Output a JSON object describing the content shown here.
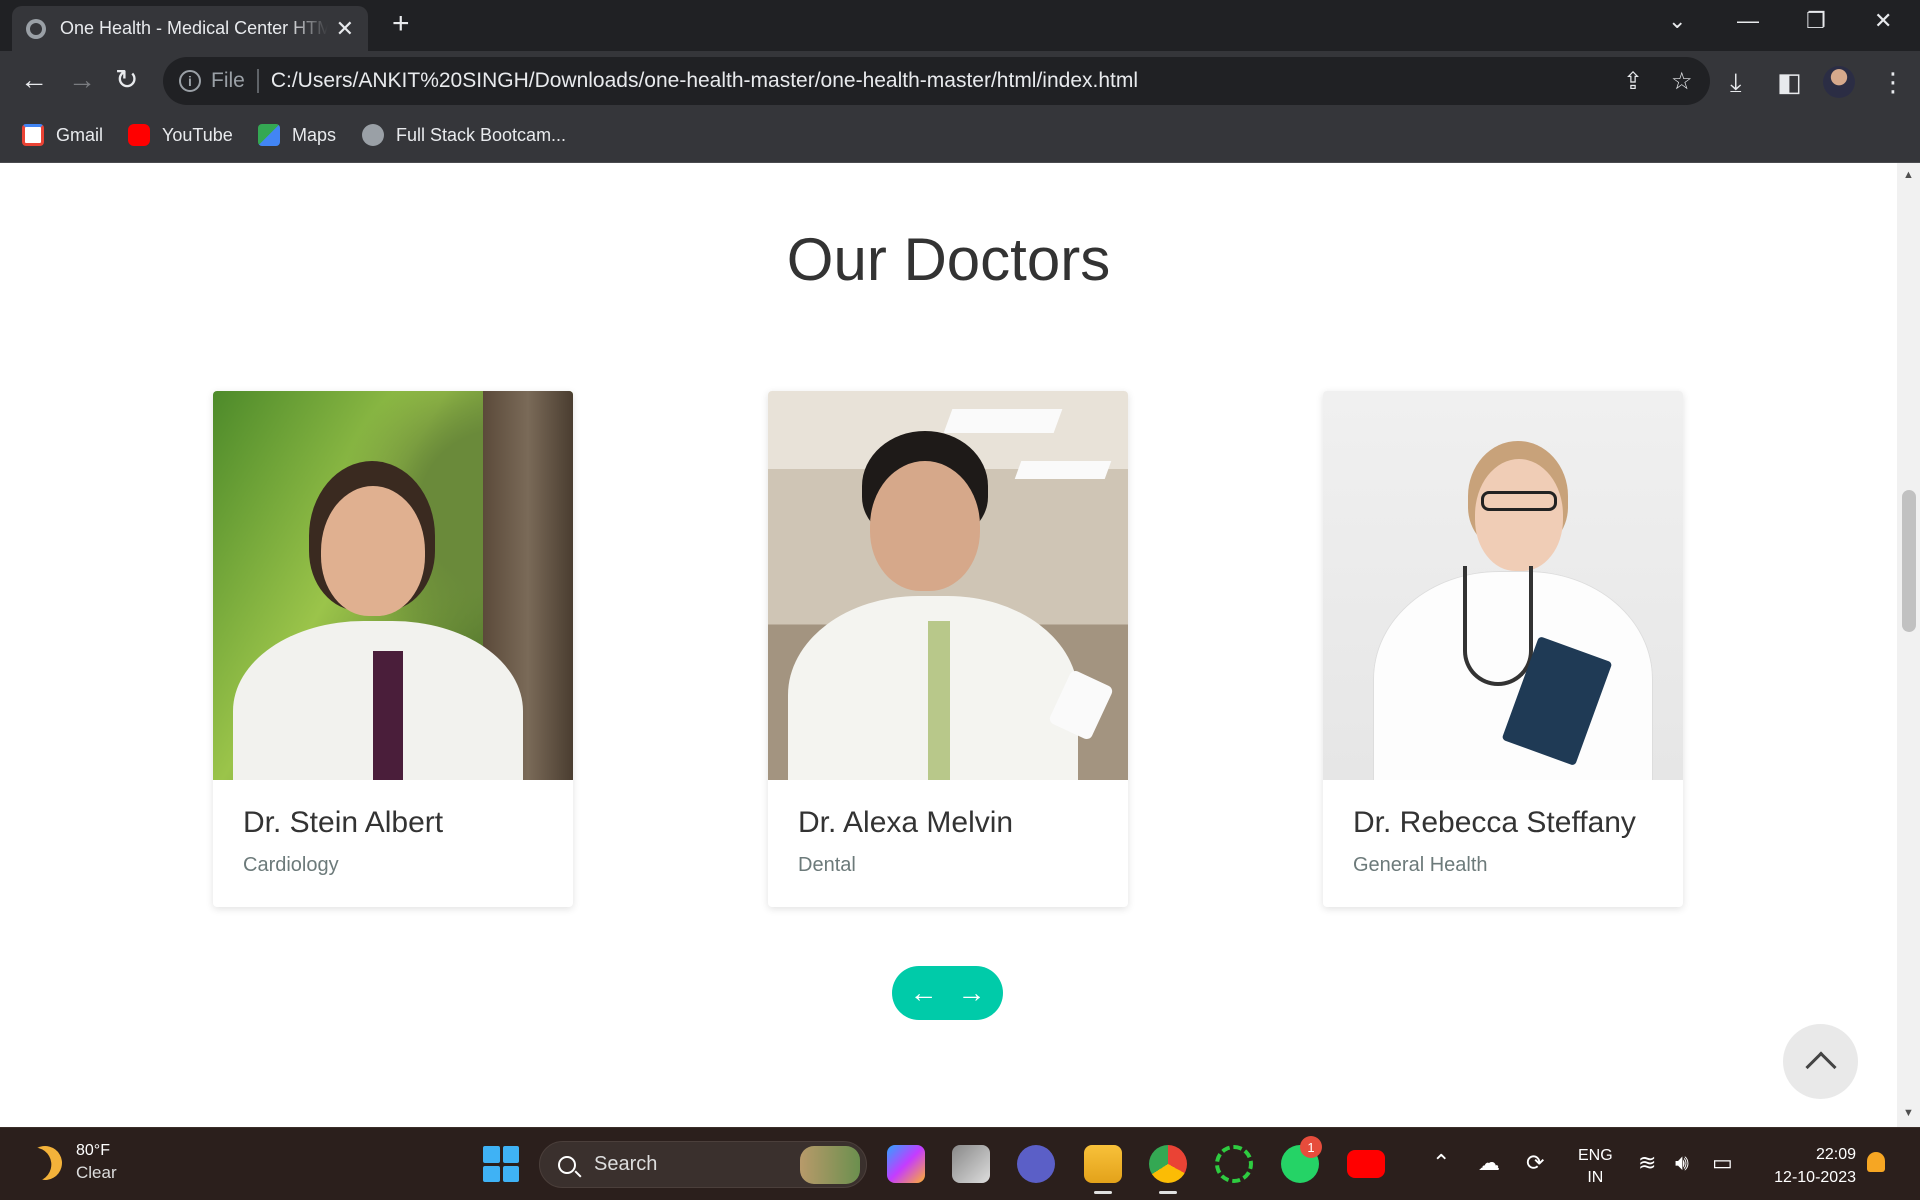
{
  "browser": {
    "tab_title": "One Health - Medical Center HTML",
    "tab_close": "✕",
    "new_tab": "+",
    "url_scheme": "File",
    "url": "C:/Users/ANKIT%20SINGH/Downloads/one-health-master/one-health-master/html/index.html",
    "bookmarks": [
      {
        "label": "Gmail",
        "icon": "gmail-icon",
        "color": "#ea4335"
      },
      {
        "label": "YouTube",
        "icon": "youtube-icon",
        "color": "#ff0000"
      },
      {
        "label": "Maps",
        "icon": "maps-icon",
        "color": "#34a853"
      },
      {
        "label": "Full Stack Bootcam...",
        "icon": "globe-icon",
        "color": "#9aa0a6"
      }
    ]
  },
  "page": {
    "section_title": "Our Doctors",
    "doctors": [
      {
        "name": "Dr. Stein Albert",
        "specialty": "Cardiology"
      },
      {
        "name": "Dr. Alexa Melvin",
        "specialty": "Dental"
      },
      {
        "name": "Dr. Rebecca Steffany",
        "specialty": "General Health"
      }
    ],
    "carousel": {
      "prev": "←",
      "next": "→"
    },
    "accent_color": "#00cba9"
  },
  "taskbar": {
    "weather_temp": "80°F",
    "weather_cond": "Clear",
    "search_label": "Search",
    "whatsapp_badge": "1",
    "lang_line1": "ENG",
    "lang_line2": "IN",
    "time": "22:09",
    "date": "12-10-2023"
  }
}
